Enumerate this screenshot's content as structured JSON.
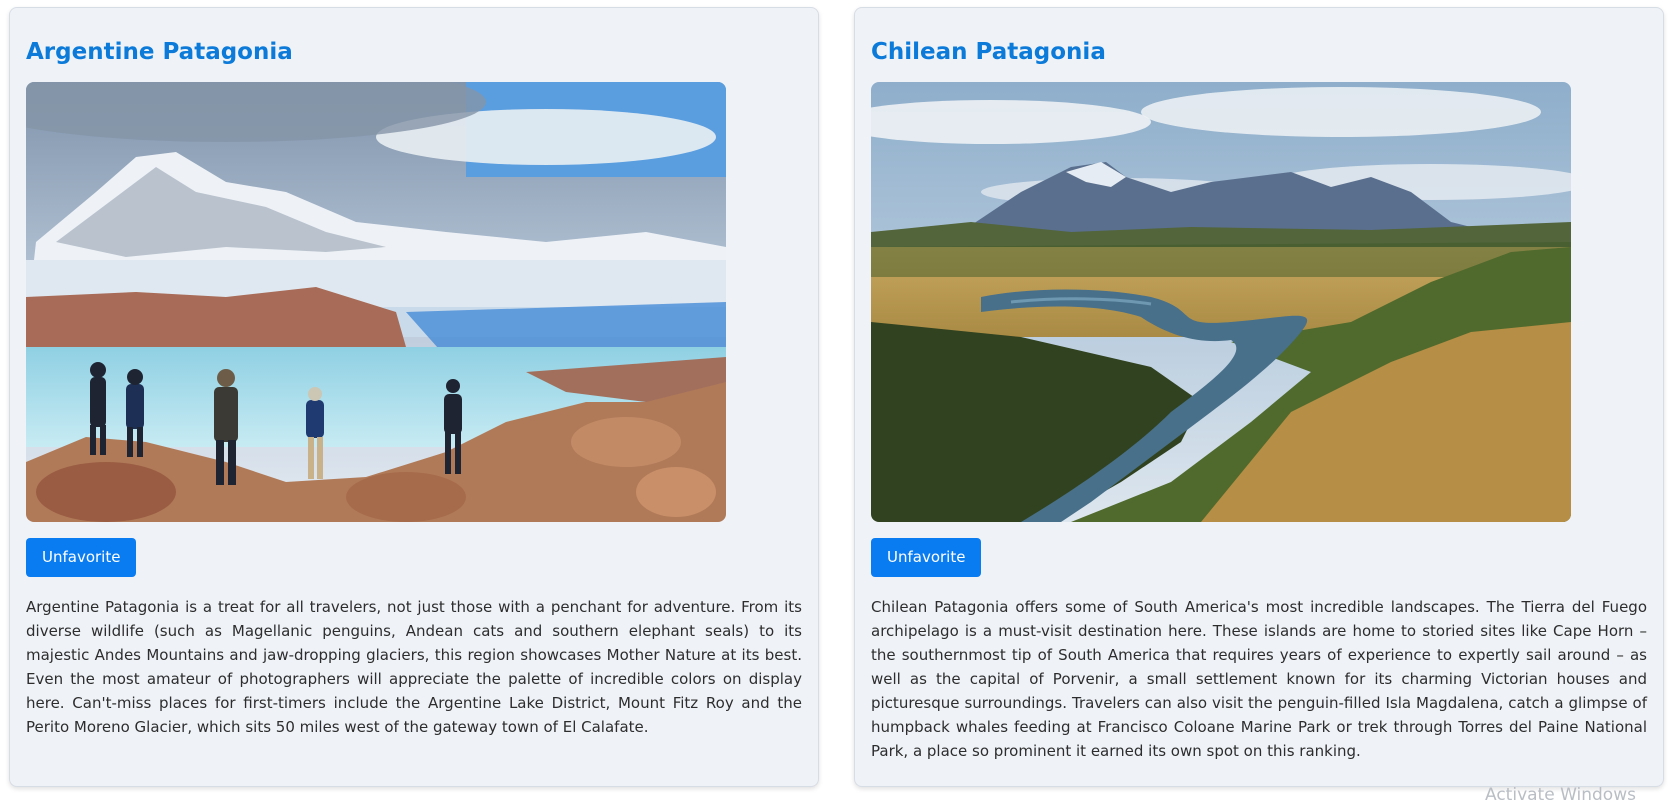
{
  "cards": [
    {
      "title": "Argentine Patagonia",
      "image_icon": "glacier-hikers-photo",
      "button_label": "Unfavorite",
      "description": "Argentine Patagonia is a treat for all travelers, not just those with a penchant for adventure. From its diverse wildlife (such as Magellanic penguins, Andean cats and southern elephant seals) to its majestic Andes Mountains and jaw-dropping glaciers, this region showcases Mother Nature at its best. Even the most amateur of photographers will appreciate the palette of incredible colors on display here. Can't-miss places for first-timers include the Argentine Lake District, Mount Fitz Roy and the Perito Moreno Glacier, which sits 50 miles west of the gateway town of El Calafate."
    },
    {
      "title": "Chilean Patagonia",
      "image_icon": "mountain-river-valley-photo",
      "button_label": "Unfavorite",
      "description": "Chilean Patagonia offers some of South America's most incredible landscapes. The Tierra del Fuego archipelago is a must-visit destination here. These islands are home to storied sites like Cape Horn – the southernmost tip of South America that requires years of experience to expertly sail around – as well as the capital of Porvenir, a small settlement known for its charming Victorian houses and picturesque surroundings. Travelers can also visit the penguin-filled Isla Magdalena, catch a glimpse of humpback whales feeding at Francisco Coloane Marine Park or trek through Torres del Paine National Park, a place so prominent it earned its own spot on this ranking."
    }
  ],
  "colors": {
    "title": "#0b7ad8",
    "button_bg": "#0a7cf2",
    "card_bg": "#eff3f8"
  },
  "watermark": "Activate Windows"
}
